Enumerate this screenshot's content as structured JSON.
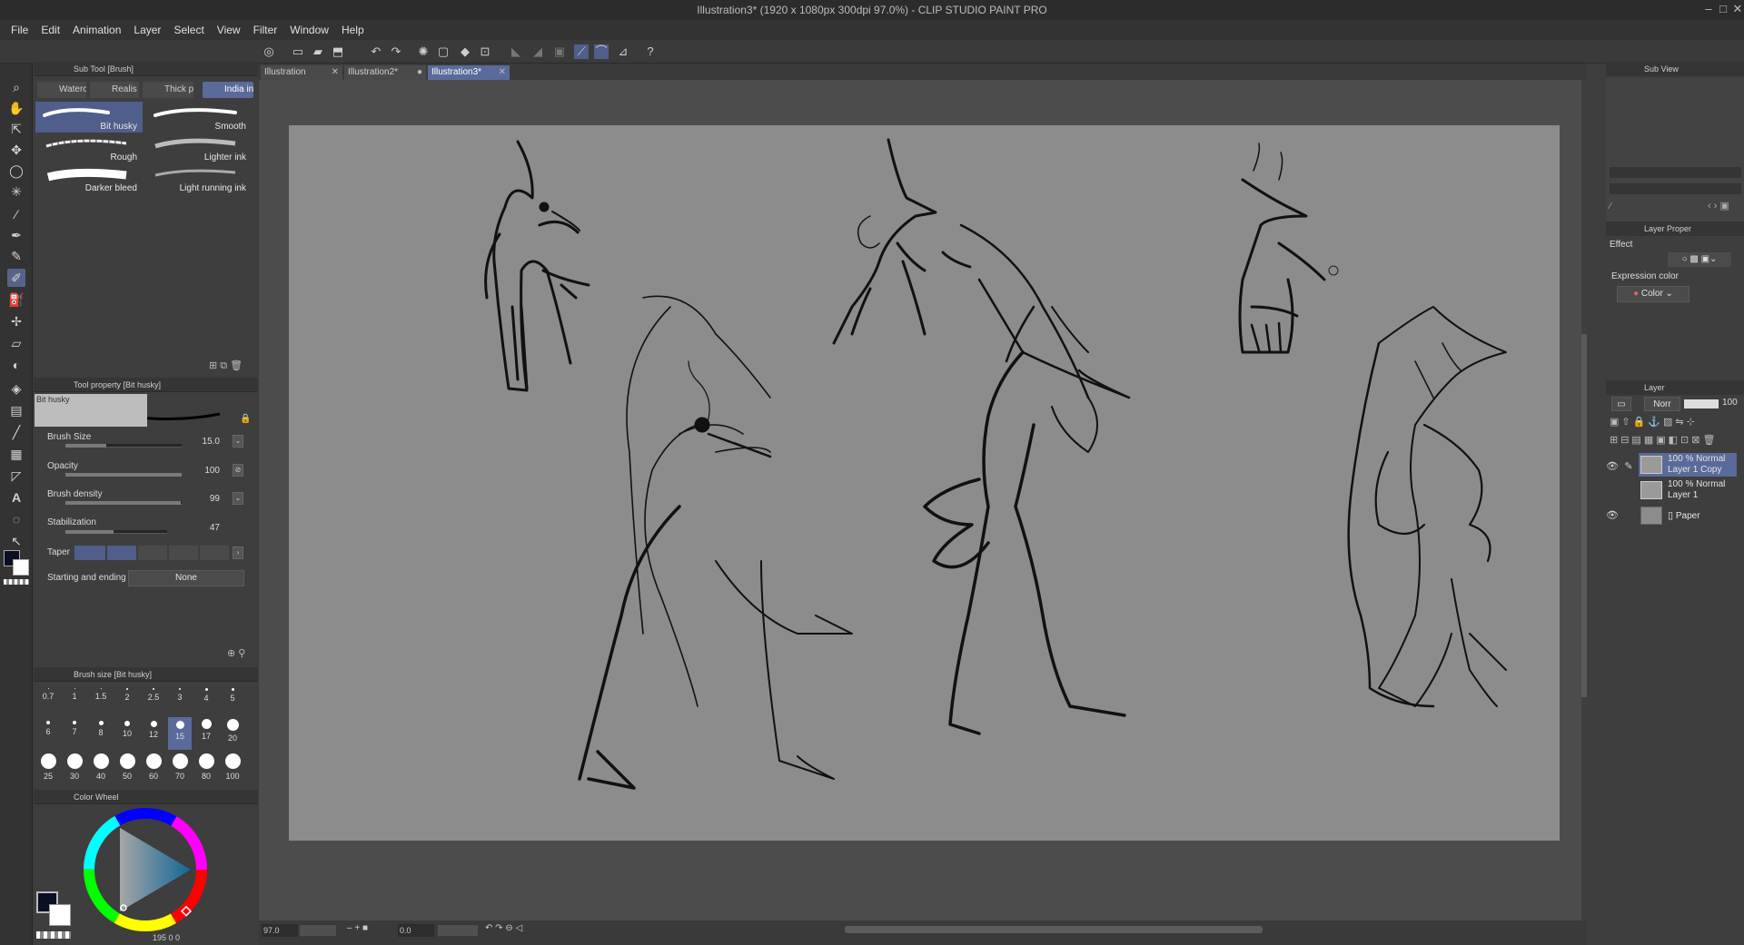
{
  "window": {
    "title": "Illustration3* (1920 x 1080px 300dpi 97.0%) - CLIP STUDIO PAINT PRO",
    "controls": [
      "–",
      "□",
      "✕"
    ]
  },
  "menu": [
    "File",
    "Edit",
    "Animation",
    "Layer",
    "Select",
    "View",
    "Filter",
    "Window",
    "Help"
  ],
  "subtool_panel": {
    "header": "Sub Tool [Brush]",
    "tabs": [
      "Waterc",
      "Realis",
      "Thick p",
      "India in"
    ],
    "brushes": [
      "Bit husky",
      "Smooth",
      "Rough",
      "Lighter ink",
      "Darker bleed",
      "Light running ink"
    ]
  },
  "tool_property": {
    "header": "Tool property [Bit husky]",
    "preview_label": "Bit husky",
    "brush_size_label": "Brush Size",
    "brush_size_value": "15.0",
    "brush_size_level": 0.35,
    "opacity_label": "Opacity",
    "opacity_value": "100",
    "opacity_level": 1.0,
    "density_label": "Brush density",
    "density_value": "99",
    "density_level": 0.99,
    "stabilization_label": "Stabilization",
    "stabilization_value": "47",
    "stabilization_level": 0.47,
    "taper_label": "Taper",
    "start_end_label": "Starting and ending",
    "start_end_value": "None"
  },
  "brush_size_panel": {
    "header": "Brush size [Bit husky]",
    "sizes": [
      "0.7",
      "1",
      "1.5",
      "2",
      "2.5",
      "3",
      "4",
      "5",
      "6",
      "7",
      "8",
      "10",
      "12",
      "15",
      "17",
      "20",
      "25",
      "30",
      "40",
      "50",
      "60",
      "70",
      "80",
      "100"
    ],
    "selected": "15"
  },
  "color_panel": {
    "header": "Color Wheel",
    "readout": "195  0  0",
    "main_color": "#0a0f24",
    "sub_color": "#ffffff"
  },
  "document_tabs": [
    {
      "label": "Illustration",
      "active": false
    },
    {
      "label": "Illustration2*",
      "active": false
    },
    {
      "label": "Illustration3*",
      "active": true
    }
  ],
  "statusbar": {
    "zoom": "97.0",
    "rotation": "0.0"
  },
  "right_panel": {
    "subview_header": "Sub View",
    "layer_prop_header": "Layer Proper",
    "effect_label": "Effect",
    "expression_label": "Expression color",
    "expression_value": "Color",
    "layer_header": "Layer",
    "blend_mode": "Norr",
    "layer_opacity": "100",
    "layers": [
      {
        "line1": "100 % Normal",
        "line2": "Layer 1 Copy",
        "selected": true,
        "visible": true
      },
      {
        "line1": "100 % Normal",
        "line2": "Layer 1",
        "selected": false,
        "visible": false
      },
      {
        "line1": "",
        "line2": "Paper",
        "selected": false,
        "visible": true
      }
    ]
  }
}
